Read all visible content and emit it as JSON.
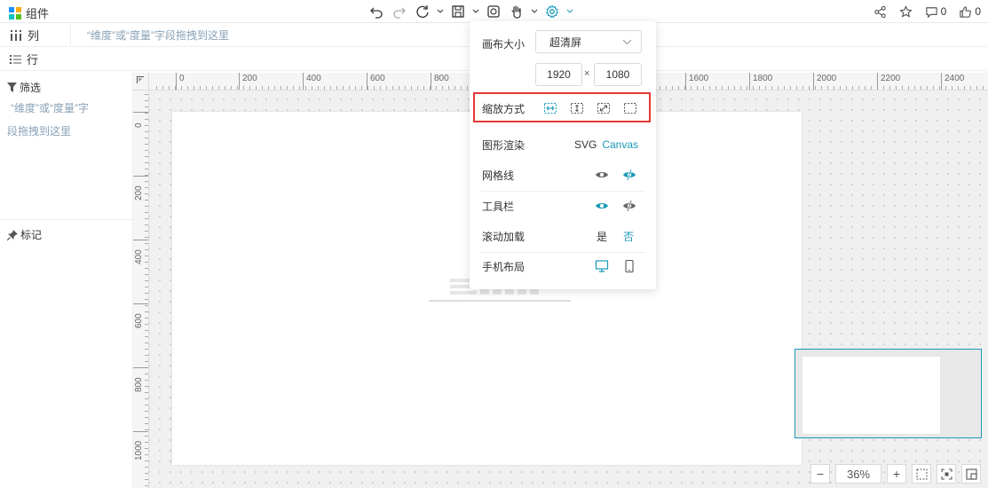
{
  "app": {
    "title": "组件"
  },
  "toolbar": {
    "icons": [
      "undo-icon",
      "redo-icon",
      "refresh-icon",
      "save-icon",
      "preview-icon",
      "hand-icon",
      "settings-icon"
    ]
  },
  "actions": {
    "comment_count": "0",
    "like_count": "0"
  },
  "shelves": {
    "columns": {
      "label": "列",
      "hint": "“维度”或“度量”字段拖拽到这里"
    },
    "rows": {
      "label": "行"
    }
  },
  "filter": {
    "title": "筛选",
    "hint_line1": "“维度”或“度量”字",
    "hint_line2": "段拖拽到这里"
  },
  "marks": {
    "title": "标记"
  },
  "ruler": {
    "h_labels": [
      "0",
      "200",
      "400",
      "600",
      "800",
      "1600",
      "1800",
      "2000",
      "2200",
      "2400"
    ],
    "v_labels": [
      "0",
      "200",
      "400",
      "600",
      "800",
      "1000"
    ]
  },
  "settings": {
    "canvas_size_label": "画布大小",
    "canvas_size_value": "超清屏",
    "width": "1920",
    "times": "×",
    "height": "1080",
    "scale_mode_label": "缩放方式",
    "render_label": "图形渲染",
    "render_svg": "SVG",
    "render_canvas": "Canvas",
    "grid_label": "网格线",
    "toolbar_label": "工具栏",
    "scroll_label": "滚动加载",
    "scroll_yes": "是",
    "scroll_no": "否",
    "mobile_label": "手机布局"
  },
  "zoom": {
    "minus": "−",
    "value": "36%",
    "plus": "+"
  },
  "colors": {
    "accent": "#1a9ab8",
    "highlight": "#e53935"
  }
}
